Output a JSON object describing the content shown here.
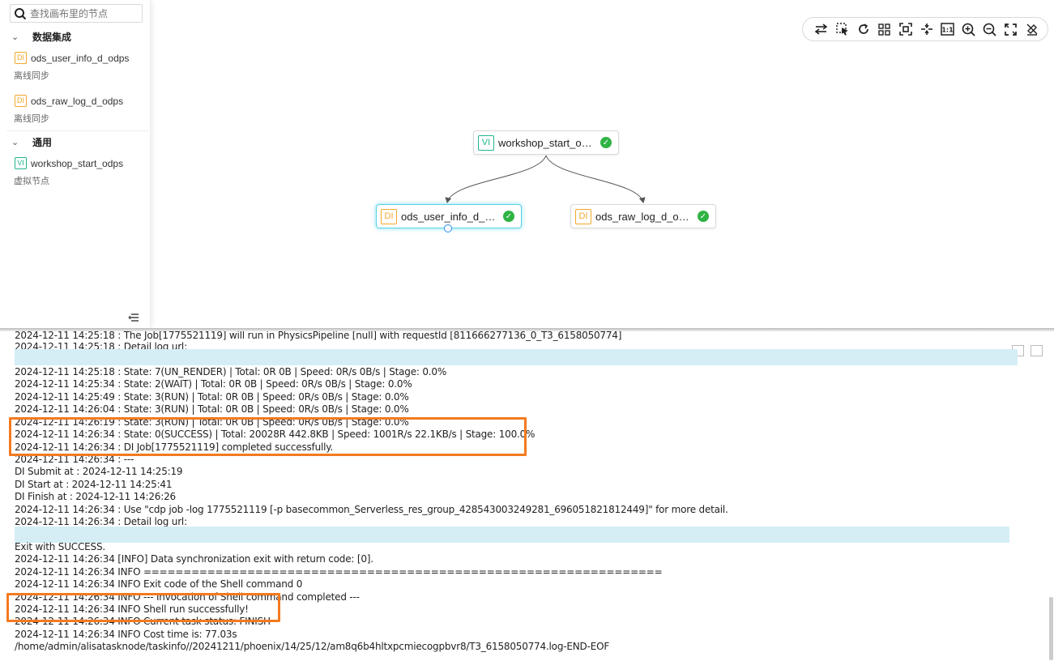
{
  "search": {
    "placeholder": "查找画布里的节点"
  },
  "sidebar": {
    "groups": [
      {
        "label": "数据集成"
      },
      {
        "label": "通用"
      }
    ],
    "items": [
      {
        "badge": "DI",
        "name": "ods_user_info_d_odps",
        "sub": "离线同步"
      },
      {
        "badge": "DI",
        "name": "ods_raw_log_d_odps",
        "sub": "离线同步"
      },
      {
        "badge": "VI",
        "name": "workshop_start_odps",
        "sub": "虚拟节点"
      }
    ],
    "collapse_icon": "menu-collapse-icon"
  },
  "toolbar": {
    "icons": [
      "swap-icon",
      "select-icon",
      "refresh-icon",
      "grid-layout-icon",
      "fit-center-icon",
      "locate-icon",
      "actual-size-icon",
      "zoom-in-icon",
      "zoom-out-icon",
      "fullscreen-icon",
      "clear-format-icon"
    ],
    "actual_size_label": "1:1"
  },
  "graph": {
    "nodes": [
      {
        "badge": "VI",
        "name": "workshop_start_odps",
        "status": "success"
      },
      {
        "badge": "DI",
        "name": "ods_user_info_d_od...",
        "status": "success"
      },
      {
        "badge": "DI",
        "name": "ods_raw_log_d_odps",
        "status": "success"
      }
    ]
  },
  "log": {
    "lines": [
      "2024-12-11 14:25:18 : The Job[1775521119] will run in PhysicsPipeline [null] with requestId [811666277136_0_T3_6158050774]",
      "2024-12-11 14:25:18 : Detail log url:",
      "2024-12-11 14:25:18 : State: 7(UN_RENDER) | Total: 0R 0B | Speed: 0R/s 0B/s | Stage: 0.0%",
      "2024-12-11 14:25:34 : State: 2(WAIT) | Total: 0R 0B | Speed: 0R/s 0B/s | Stage: 0.0%",
      "2024-12-11 14:25:49 : State: 3(RUN) | Total: 0R 0B | Speed: 0R/s 0B/s | Stage: 0.0%",
      "2024-12-11 14:26:04 : State: 3(RUN) | Total: 0R 0B | Speed: 0R/s 0B/s | Stage: 0.0%",
      "2024-12-11 14:26:19 : State: 3(RUN) | Total: 0R 0B | Speed: 0R/s 0B/s | Stage: 0.0%",
      "2024-12-11 14:26:34 : State: 0(SUCCESS) | Total: 20028R 442.8KB | Speed: 1001R/s 22.1KB/s | Stage: 100.0%",
      "2024-12-11 14:26:34 : DI Job[1775521119] completed successfully.",
      "2024-12-11 14:26:34 : ---",
      "DI Submit at : 2024-12-11 14:25:19",
      "DI Start at : 2024-12-11 14:25:41",
      "DI Finish at : 2024-12-11 14:26:26",
      "2024-12-11 14:26:34 : Use \"cdp job -log 1775521119 [-p basecommon_Serverless_res_group_428543003249281_696051821812449]\" for more detail.",
      "2024-12-11 14:26:34 : Detail log url:",
      "Exit with SUCCESS.",
      "2024-12-11 14:26:34 [INFO] Data synchronization exit with return code: [0].",
      "2024-12-11 14:26:34 INFO =================================================================",
      "2024-12-11 14:26:34 INFO Exit code of the Shell command 0",
      "2024-12-11 14:26:34 INFO --- Invocation of Shell command completed ---",
      "2024-12-11 14:26:34 INFO Shell run successfully!",
      "2024-12-11 14:26:34 INFO Current task status: FINISH",
      "2024-12-11 14:26:34 INFO Cost time is: 77.03s",
      "/home/admin/alisatasknode/taskinfo//20241211/phoenix/14/25/12/am8q6b4hltxpcmiecogpbvr8/T3_6158050774.log-END-EOF"
    ]
  },
  "colors": {
    "highlight": "#f47a1f",
    "success": "#2fb344",
    "di_badge": "#f4a72c",
    "vi_badge": "#1fb68e",
    "url_mask": "#d5eef6"
  }
}
